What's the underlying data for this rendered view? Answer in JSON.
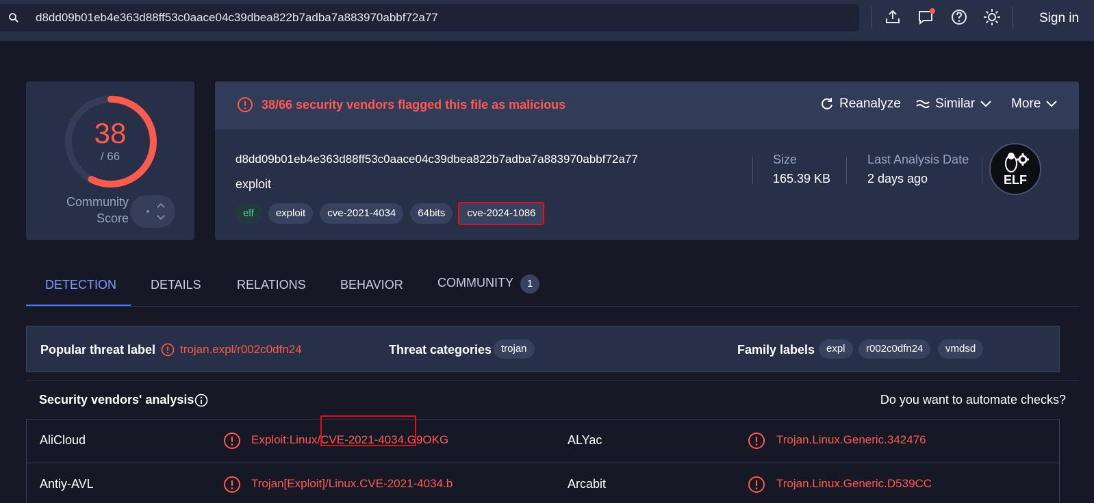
{
  "search": {
    "value": "d8dd09b01eb4e363d88ff53c0aace04c39dbea822b7adba7a883970abbf72a77"
  },
  "topbar": {
    "signin": "Sign in",
    "icons": [
      "upload-icon",
      "chat-icon",
      "help-icon",
      "theme-icon"
    ]
  },
  "score": {
    "detections": "38",
    "total": "/ 66",
    "community_label_1": "Community",
    "community_label_2": "Score",
    "fraction": 0.576
  },
  "banner": {
    "warning": "38/66 security vendors flagged this file as malicious",
    "reanalyze": "Reanalyze",
    "similar": "Similar",
    "more": "More"
  },
  "file": {
    "hash": "d8dd09b01eb4e363d88ff53c0aace04c39dbea822b7adba7a883970abbf72a77",
    "type": "exploit",
    "tags": [
      "elf",
      "exploit",
      "cve-2021-4034",
      "64bits",
      "cve-2024-1086"
    ],
    "size_label": "Size",
    "size_value": "165.39 KB",
    "date_label": "Last Analysis Date",
    "date_value": "2 days ago",
    "format_badge": "ELF"
  },
  "tabs": {
    "detection": "DETECTION",
    "details": "DETAILS",
    "relations": "RELATIONS",
    "behavior": "BEHAVIOR",
    "community": "COMMUNITY",
    "community_count": "1"
  },
  "threat": {
    "popular_label": "Popular threat label",
    "popular_value": "trojan.expl/r002c0dfn24",
    "categories_label": "Threat categories",
    "categories": [
      "trojan"
    ],
    "family_label": "Family labels",
    "families": [
      "expl",
      "r002c0dfn24",
      "vmdsd"
    ]
  },
  "vendors": {
    "title": "Security vendors' analysis",
    "automate": "Do you want to automate checks?",
    "rows": [
      {
        "left_name": "AliCloud",
        "left_result": "Exploit:Linux/CVE-2021-4034.G9OKG",
        "right_name": "ALYac",
        "right_result": "Trojan.Linux.Generic.342476"
      },
      {
        "left_name": "Antiy-AVL",
        "left_result": "Trojan[Exploit]/Linux.CVE-2021-4034.b",
        "right_name": "Arcabit",
        "right_result": "Trojan.Linux.Generic.D539CC"
      }
    ]
  },
  "colors": {
    "accent": "#4f73ff",
    "danger": "#ff5a4e",
    "highlight": "#e80f12"
  }
}
